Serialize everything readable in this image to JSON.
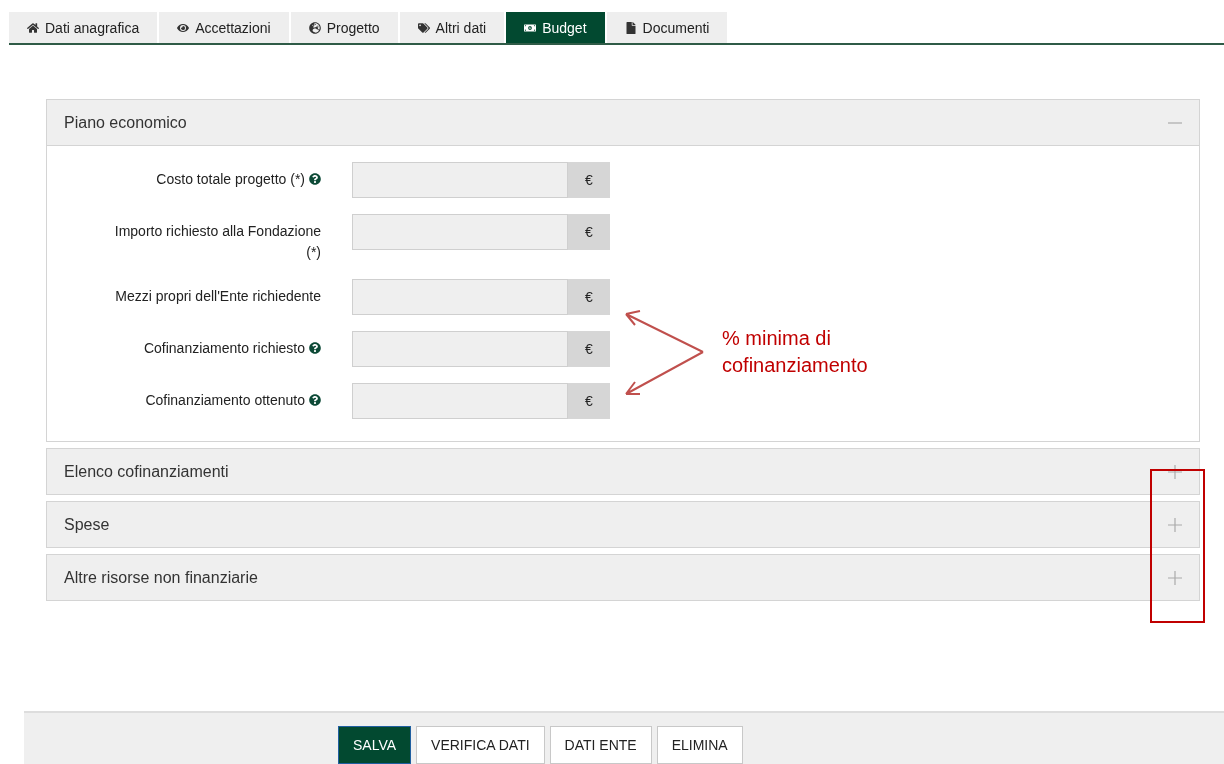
{
  "tabs": [
    {
      "label": "Dati anagrafica",
      "kind": "home",
      "selected": false
    },
    {
      "label": "Accettazioni",
      "kind": "eye",
      "selected": false
    },
    {
      "label": "Progetto",
      "kind": "globe",
      "selected": false
    },
    {
      "label": "Altri dati",
      "kind": "tags",
      "selected": false
    },
    {
      "label": "Budget",
      "kind": "money",
      "selected": true
    },
    {
      "label": "Documenti",
      "kind": "file",
      "selected": false
    }
  ],
  "panels": [
    {
      "title": "Piano economico",
      "expanded": true,
      "fields": [
        {
          "label": "Costo totale progetto (*)",
          "help": true,
          "addon": "€"
        },
        {
          "label": "Importo richiesto alla Fondazione (*)",
          "help": false,
          "addon": "€"
        },
        {
          "label": "Mezzi propri dell'Ente richiedente",
          "help": false,
          "addon": "€"
        },
        {
          "label": "Cofinanziamento richiesto",
          "help": true,
          "addon": "€"
        },
        {
          "label": "Cofinanziamento ottenuto",
          "help": true,
          "addon": "€"
        }
      ]
    },
    {
      "title": "Elenco cofinanziamenti",
      "expanded": false
    },
    {
      "title": "Spese",
      "expanded": false
    },
    {
      "title": "Altre risorse non finanziarie",
      "expanded": false
    }
  ],
  "annotation": {
    "text": "% minima di cofinanziamento"
  },
  "buttons": [
    {
      "label": "SALVA",
      "primary": true
    },
    {
      "label": "VERIFICA DATI",
      "primary": false
    },
    {
      "label": "DATI ENTE",
      "primary": false
    },
    {
      "label": "ELIMINA",
      "primary": false
    }
  ]
}
